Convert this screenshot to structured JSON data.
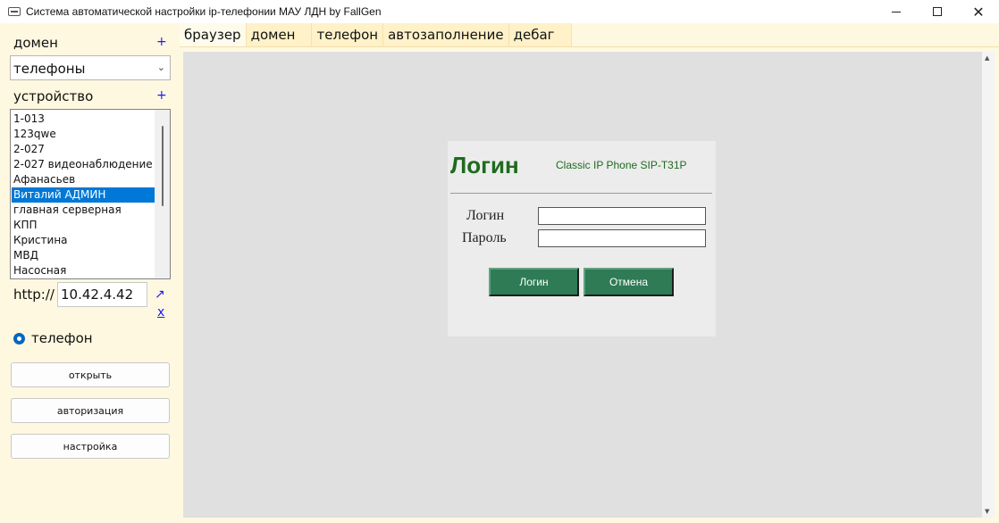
{
  "window": {
    "title": "Система автоматической настройки ip-телефонии МАУ ЛДН by FallGen",
    "minimize": "",
    "maximize": "",
    "close": "✕"
  },
  "sidebar": {
    "domain_label": "домен",
    "domain_add": "+",
    "domain_selected": "телефоны",
    "device_label": "устройство",
    "device_add": "+",
    "devices": [
      "1-013",
      "123qwe",
      "2-027",
      "2-027 видеонаблюдение",
      "Афанасьев",
      "Виталий АДМИН",
      "главная серверная",
      "КПП",
      "Кристина",
      "МВД",
      "Насосная"
    ],
    "selected_device": "Виталий АДМИН",
    "url_prefix": "http://",
    "url_value": "10.42.4.42",
    "open_link_icon": "↗",
    "clear_link": "x",
    "radio_label": "телефон",
    "buttons": {
      "open": "открыть",
      "auth": "авторизация",
      "settings": "настройка"
    }
  },
  "tabs": [
    "браузер",
    "домен",
    "телефон",
    "автозаполнение",
    "дебаг"
  ],
  "active_tab": "браузер",
  "browser": {
    "login_title": "Логин",
    "model": "Classic IP Phone SIP-T31P",
    "login_label": "Логин",
    "password_label": "Пароль",
    "login_button": "Логин",
    "cancel_button": "Отмена"
  },
  "colors": {
    "background": "#fff8e0",
    "accent_green": "#2e7b55",
    "title_green": "#1e6b1e",
    "selection": "#0078d7"
  }
}
